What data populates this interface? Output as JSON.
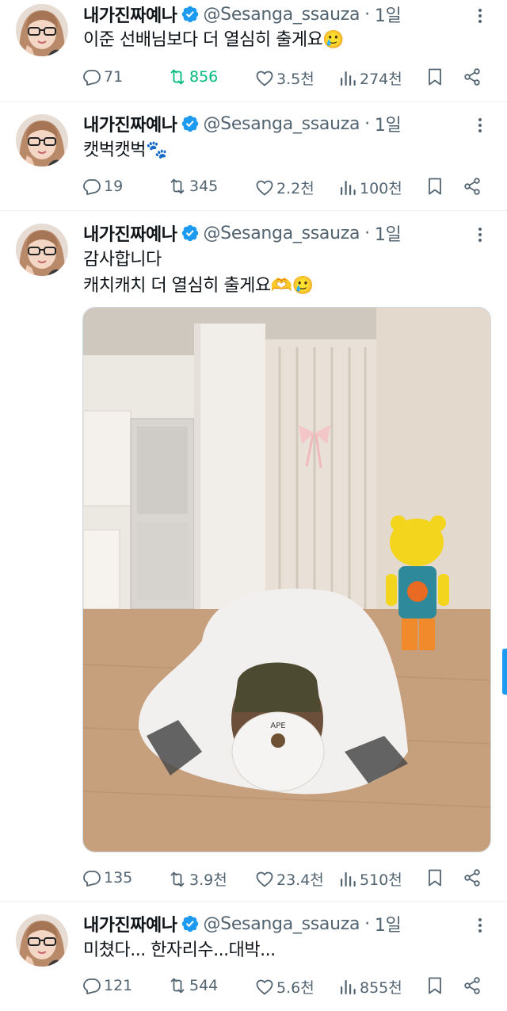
{
  "colors": {
    "verified": "#1d9bf0",
    "retweet_active": "#00ba7c",
    "secondary_text": "#536471"
  },
  "tweets": [
    {
      "author": "내가진짜예나",
      "handle": "@Sesanga_ssauza",
      "separator": "·",
      "time": "1일",
      "lines": [
        "이준 선배님보다 더 열심히 출게요🥲"
      ],
      "replies": "71",
      "retweets": "856",
      "retweeted": true,
      "likes": "3.5천",
      "views": "274천"
    },
    {
      "author": "내가진짜예나",
      "handle": "@Sesanga_ssauza",
      "separator": "·",
      "time": "1일",
      "lines": [
        "캣벅캣벅🐾"
      ],
      "replies": "19",
      "retweets": "345",
      "retweeted": false,
      "likes": "2.2천",
      "views": "100천"
    },
    {
      "author": "내가진짜예나",
      "handle": "@Sesanga_ssauza",
      "separator": "·",
      "time": "1일",
      "lines": [
        "감사합니다",
        "캐치캐치 더 열심히 출게요🫶🥲"
      ],
      "media": "photo",
      "replies": "135",
      "retweets": "3.9천",
      "retweeted": false,
      "likes": "23.4천",
      "views": "510천"
    },
    {
      "author": "내가진짜예나",
      "handle": "@Sesanga_ssauza",
      "separator": "·",
      "time": "1일",
      "lines": [
        "미쳤다... 한자리수...대박..."
      ],
      "replies": "121",
      "retweets": "544",
      "retweeted": false,
      "likes": "5.6천",
      "views": "855천"
    }
  ]
}
